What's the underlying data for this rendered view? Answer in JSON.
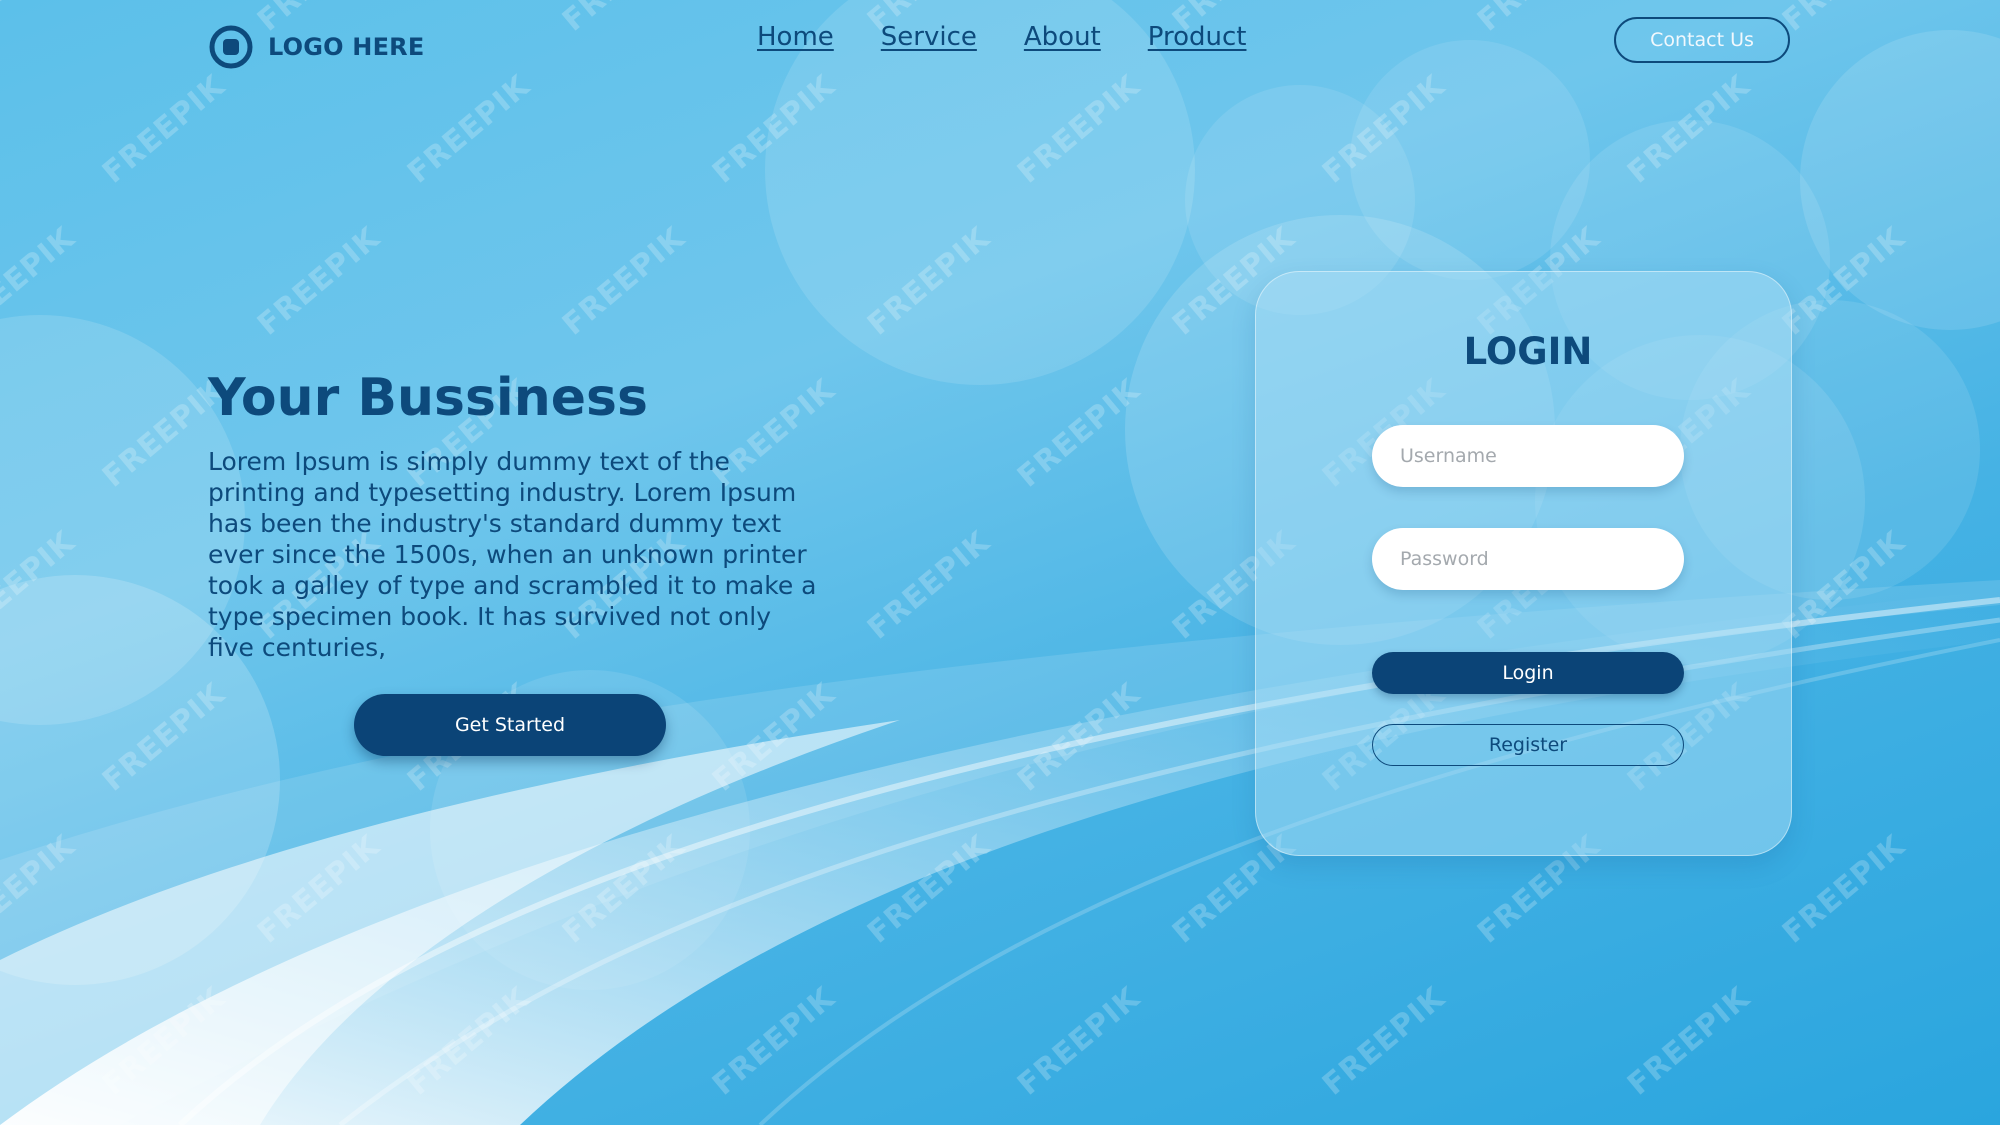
{
  "logo": {
    "text": "LOGO HERE"
  },
  "nav": {
    "items": [
      {
        "label": "Home"
      },
      {
        "label": "Service"
      },
      {
        "label": "About"
      },
      {
        "label": "Product"
      }
    ],
    "contact_label": "Contact Us"
  },
  "hero": {
    "title": "Your Bussiness",
    "text": "Lorem Ipsum is simply dummy text of the printing and typesetting industry. Lorem Ipsum has been the industry's standard dummy text ever since the 1500s, when an unknown printer took a galley of type and scrambled it to make a type specimen book. It has survived not only five centuries,",
    "cta_label": "Get Started"
  },
  "login": {
    "title": "LOGIN",
    "username_placeholder": "Username",
    "password_placeholder": "Password",
    "login_label": "Login",
    "register_label": "Register"
  },
  "watermark": {
    "text": "FREEPIK"
  },
  "colors": {
    "primary": "#0b4477",
    "text_dark": "#0d4a7c",
    "background": "#5cc0ea",
    "background_deep": "#2aa5de"
  }
}
